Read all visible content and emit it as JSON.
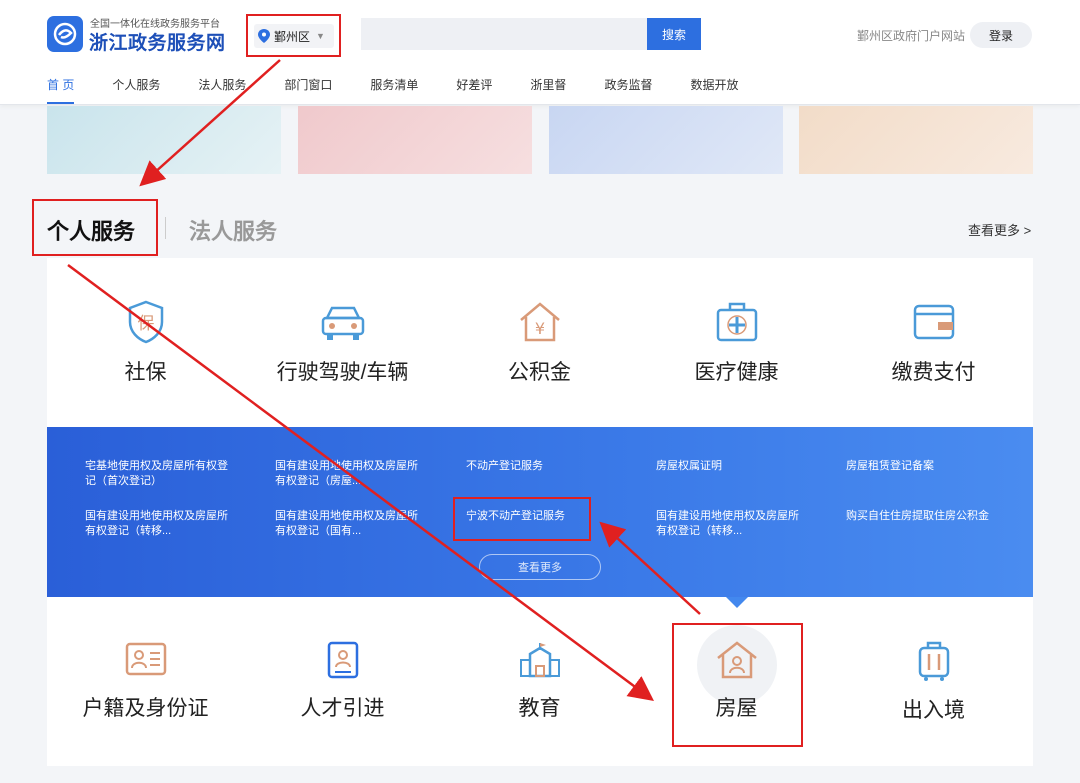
{
  "header": {
    "logo_sub": "全国一体化在线政务服务平台",
    "logo_title": "浙江政务服务网",
    "location": "鄞州区",
    "search_button": "搜索",
    "portal_link": "鄞州区政府门户网站",
    "login": "登录"
  },
  "nav": [
    "首 页",
    "个人服务",
    "法人服务",
    "部门窗口",
    "服务清单",
    "好差评",
    "浙里督",
    "政务监督",
    "数据开放"
  ],
  "section": {
    "tab_personal": "个人服务",
    "tab_legal": "法人服务",
    "view_more": "查看更多"
  },
  "categories_row1": [
    {
      "label": "社保",
      "icon": "shield-bao-icon"
    },
    {
      "label": "行驶驾驶/车辆",
      "icon": "car-icon"
    },
    {
      "label": "公积金",
      "icon": "house-yen-icon"
    },
    {
      "label": "医疗健康",
      "icon": "medical-kit-icon"
    },
    {
      "label": "缴费支付",
      "icon": "wallet-icon"
    }
  ],
  "services": [
    "宅基地使用权及房屋所有权登记（首次登记）",
    "国有建设用地使用权及房屋所有权登记（房屋...",
    "不动产登记服务",
    "房屋权属证明",
    "房屋租赁登记备案",
    "国有建设用地使用权及房屋所有权登记（转移...",
    "国有建设用地使用权及房屋所有权登记（国有...",
    "宁波不动产登记服务",
    "国有建设用地使用权及房屋所有权登记（转移...",
    "购买自住住房提取住房公积金"
  ],
  "services_more": "查看更多",
  "categories_row2": [
    {
      "label": "户籍及身份证",
      "icon": "id-card-icon"
    },
    {
      "label": "人才引进",
      "icon": "badge-icon"
    },
    {
      "label": "教育",
      "icon": "school-icon"
    },
    {
      "label": "房屋",
      "icon": "house-person-icon"
    },
    {
      "label": "出入境",
      "icon": "luggage-icon"
    }
  ],
  "colors": {
    "accent": "#2d6fe0",
    "highlight": "#e02020",
    "icon_orange": "#d99a78",
    "icon_blue": "#4a9ad8"
  }
}
